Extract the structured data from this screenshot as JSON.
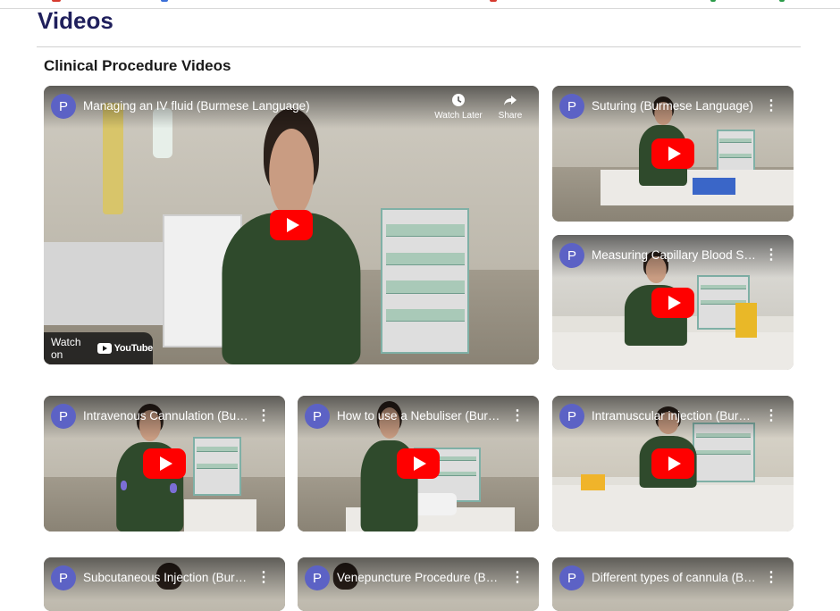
{
  "page": {
    "title": "Videos",
    "section_title": "Clinical Procedure Videos"
  },
  "colors": {
    "title": "#1f1f5c",
    "channel_avatar": "#5c62c5",
    "play_button": "#ff0000"
  },
  "featured": {
    "channel_initial": "P",
    "title": "Managing an IV fluid (Burmese Language)",
    "watch_later_label": "Watch Later",
    "share_label": "Share",
    "watch_on_label": "Watch on",
    "youtube_label": "YouTube"
  },
  "videos": [
    {
      "channel_initial": "P",
      "title": "Suturing (Burmese Language)"
    },
    {
      "channel_initial": "P",
      "title": "Measuring Capillary Blood Sug..."
    },
    {
      "channel_initial": "P",
      "title": "Intravenous Cannulation (Bur..."
    },
    {
      "channel_initial": "P",
      "title": "How to use a Nebuliser (Burm..."
    },
    {
      "channel_initial": "P",
      "title": "Intramuscular injection (Burm..."
    },
    {
      "channel_initial": "P",
      "title": "Subcutaneous Injection (Burm..."
    },
    {
      "channel_initial": "P",
      "title": "Venepuncture Procedure (Bur..."
    },
    {
      "channel_initial": "P",
      "title": "Different types of cannula (Bur..."
    }
  ],
  "icons": {
    "menu": "more-vert-icon",
    "play": "youtube-play-icon",
    "watch_later": "clock-icon",
    "share": "share-arrow-icon"
  }
}
